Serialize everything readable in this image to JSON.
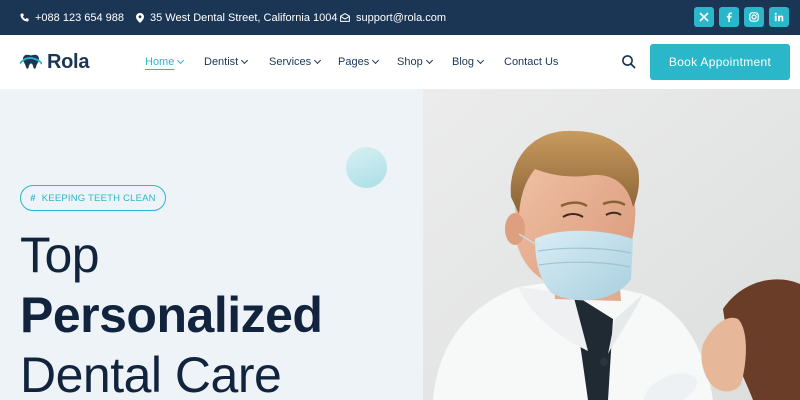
{
  "topbar": {
    "phone": "+088 123 654 988",
    "address": "35 West Dental Street, California 1004",
    "email": "support@rola.com",
    "social": [
      "x-icon",
      "facebook-icon",
      "instagram-icon",
      "linkedin-icon"
    ]
  },
  "brand": {
    "name": "Rola"
  },
  "nav": {
    "items": [
      {
        "label": "Home",
        "has_dropdown": true,
        "active": true
      },
      {
        "label": "Dentist",
        "has_dropdown": true
      },
      {
        "label": "Services",
        "has_dropdown": true
      },
      {
        "label": "Pages",
        "has_dropdown": true
      },
      {
        "label": "Shop",
        "has_dropdown": true
      },
      {
        "label": "Blog",
        "has_dropdown": true
      },
      {
        "label": "Contact Us",
        "has_dropdown": false
      }
    ],
    "search_icon": "search-icon",
    "cta": "Book Appointment"
  },
  "hero": {
    "tag": "KEEPING TEETH CLEAN",
    "line1": "Top",
    "line2": "Personalized",
    "line3": "Dental Care"
  },
  "colors": {
    "accent": "#2ab7ca",
    "dark": "#1b3655",
    "heading": "#12243d",
    "hero_bg": "#eef3f8"
  }
}
